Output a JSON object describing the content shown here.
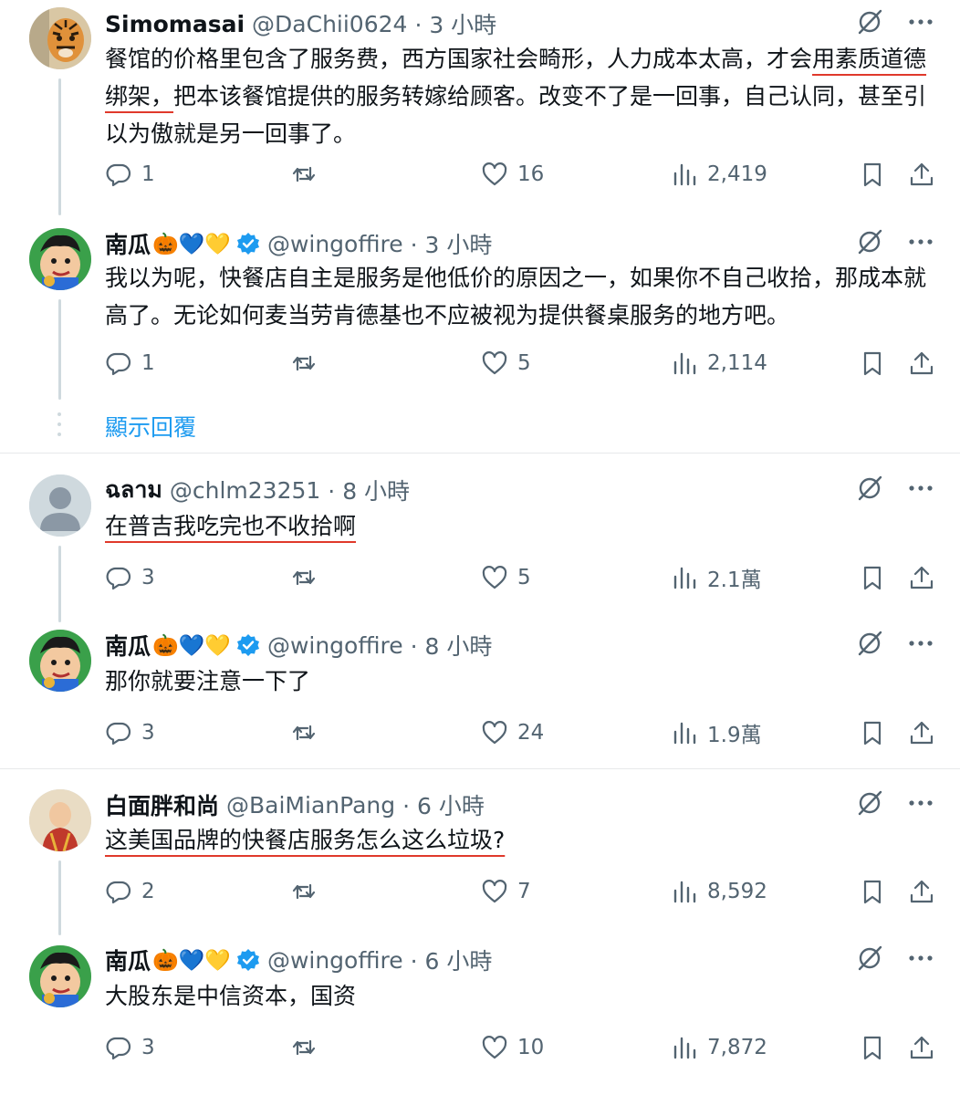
{
  "tweets": [
    {
      "name": "Simomasai",
      "emoji": "",
      "verified": false,
      "handle": "@DaChii0624",
      "time": "· 3 小時",
      "text_parts": [
        "餐馆的价格里包含了服务费，西方国家社会畸形，人力成本太高，才会",
        "用素质道德绑架，",
        "把本该餐馆提供的服务转嫁给顾客。改变不了是一回事，自己认同，甚至引以为傲就是另一回事了。"
      ],
      "replies": "1",
      "retweets": "",
      "likes": "16",
      "views": "2,419",
      "avatar": "tiger"
    },
    {
      "name": "南瓜",
      "emoji": "🎃💙💛",
      "verified": true,
      "handle": "@wingoffire",
      "time": "· 3 小時",
      "text": "我以为呢，快餐店自主是服务是他低价的原因之一，如果你不自己收拾，那成本就高了。无论如何麦当劳肯德基也不应被视为提供餐桌服务的地方吧。",
      "replies": "1",
      "retweets": "",
      "likes": "5",
      "views": "2,114",
      "avatar": "cartoon"
    },
    {
      "name": "ฉลาม",
      "emoji": "",
      "verified": false,
      "handle": "@chlm23251",
      "time": "· 8 小時",
      "text": "在普吉我吃完也不收拾啊",
      "replies": "3",
      "retweets": "",
      "likes": "5",
      "views": "2.1萬",
      "avatar": "default"
    },
    {
      "name": "南瓜",
      "emoji": "🎃💙💛",
      "verified": true,
      "handle": "@wingoffire",
      "time": "· 8 小時",
      "text": "那你就要注意一下了",
      "replies": "3",
      "retweets": "",
      "likes": "24",
      "views": "1.9萬",
      "avatar": "cartoon"
    },
    {
      "name": "白面胖和尚",
      "emoji": "",
      "verified": false,
      "handle": "@BaiMianPang",
      "time": "· 6 小時",
      "text": "这美国品牌的快餐店服务怎么这么垃圾?",
      "replies": "2",
      "retweets": "",
      "likes": "7",
      "views": "8,592",
      "avatar": "monk"
    },
    {
      "name": "南瓜",
      "emoji": "🎃💙💛",
      "verified": true,
      "handle": "@wingoffire",
      "time": "· 6 小時",
      "text": "大股东是中信资本，国资",
      "replies": "3",
      "retweets": "",
      "likes": "10",
      "views": "7,872",
      "avatar": "cartoon"
    }
  ],
  "show_replies_label": "顯示回覆",
  "icons": {
    "reply": "reply-icon",
    "retweet": "retweet-icon",
    "like": "heart-icon",
    "views": "views-icon",
    "bookmark": "bookmark-icon",
    "share": "share-icon",
    "grok": "grok-icon",
    "more": "more-icon"
  },
  "colors": {
    "text": "#0f1419",
    "secondary": "#536471",
    "link": "#1d9bf0",
    "verified": "#1d9bf0",
    "underline_annotation": "#e0392b"
  }
}
